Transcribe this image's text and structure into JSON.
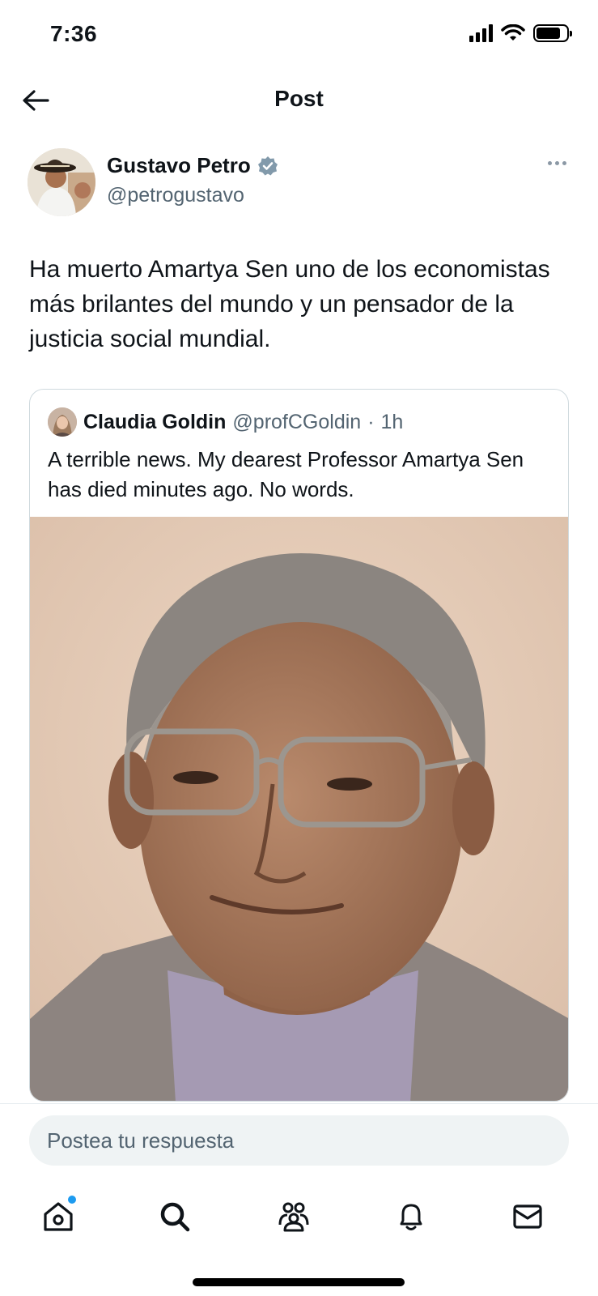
{
  "status_bar": {
    "time": "7:36",
    "icons": [
      "cellular-signal-icon",
      "wifi-icon",
      "battery-icon"
    ],
    "battery_level": 0.8
  },
  "header": {
    "title": "Post",
    "back_icon": "arrow-left-icon"
  },
  "post": {
    "author": {
      "name": "Gustavo Petro",
      "handle": "@petrogustavo",
      "verified": true
    },
    "text": "Ha muerto Amartya Sen uno de los economistas más brilantes del mundo y un pensador de la justicia social mundial.",
    "quoted": {
      "author_name": "Claudia Goldin",
      "handle": "@profCGoldin",
      "separator": "·",
      "time": "1h",
      "text": "A terrible news. My dearest Professor Amartya Sen has died minutes ago. No words."
    }
  },
  "reply": {
    "placeholder": "Postea tu respuesta"
  },
  "nav": {
    "items": [
      "home-icon",
      "search-icon",
      "communities-icon",
      "notifications-icon",
      "messages-icon"
    ],
    "home_has_badge": true
  },
  "colors": {
    "accent": "#1d9bf0",
    "text_primary": "#0f1419",
    "text_secondary": "#536471",
    "verified": "#829aab"
  }
}
